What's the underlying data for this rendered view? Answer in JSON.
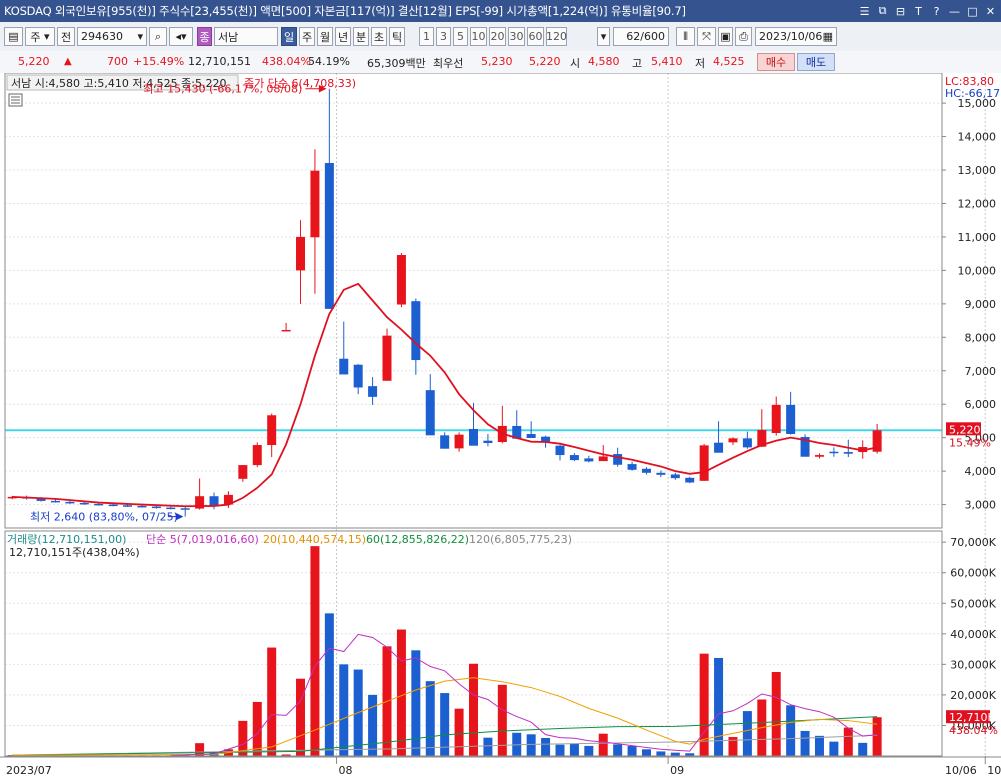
{
  "title_info": "KOSDAQ 외국인보유[955(천)] 주식수[23,455(천)] 액면[500] 자본금[117(억)] 결산[12월] EPS[-99] 시가총액[1,224(억)] 유통비율[90.7]",
  "window_icons": [
    "☰",
    "⧉",
    "⊟",
    "T",
    "?",
    "—",
    "□",
    "✕"
  ],
  "toolbar": {
    "type_label": "주",
    "prev_label": "전",
    "code": "294630",
    "stock_tag": "종",
    "stock_name": "서남",
    "periods": [
      "일",
      "주",
      "월",
      "년",
      "분",
      "초",
      "틱"
    ],
    "active_period": "일",
    "intervals": [
      "1",
      "3",
      "5",
      "10",
      "20",
      "30",
      "60",
      "120"
    ],
    "count": "62",
    "count_total": "/600",
    "date": "2023/10/06"
  },
  "quote": {
    "price": "5,220",
    "up_arrow": "▲",
    "change": "700",
    "change_pct": "+15.49%",
    "volume": "12,710,151",
    "vol_ratio": "438.04%",
    "turnover": "54.19%",
    "amount": "65,309백만",
    "best_label": "최우선",
    "best_ask": "5,230",
    "best_bid": "5,220",
    "open_label": "시",
    "open": "4,580",
    "high_label": "고",
    "high": "5,410",
    "low_label": "저",
    "low": "4,525",
    "buy_label": "매수",
    "sell_label": "매도"
  },
  "price_panel": {
    "ohlc_text": "서남 시:4,580 고:5,410 저:4,525 종:5,220",
    "ma_legend": "종가 단순 6(4,708,33)",
    "high_annot": "최고 15,430 (-66,17%, 08/08)",
    "low_annot": "최저 2,640 (83,80%, 07/25)",
    "lc_label": "LC:83,80",
    "hc_label": "HC:-66,17",
    "y_ticks": [
      "3,000",
      "4,000",
      "5,000",
      "6,000",
      "7,000",
      "8,000",
      "9,000",
      "10,000",
      "11,000",
      "12,000",
      "13,000",
      "14,000",
      "15,000"
    ],
    "price_tag": "5,220",
    "pct_tag": "15.49%"
  },
  "volume_panel": {
    "legend": [
      "거래량(12,710,151,00)",
      "단순 5(7,019,016,60)",
      "20(10,440,574,15)",
      "60(12,855,826,22)",
      "120(6,805,775,23)"
    ],
    "sub": "12,710,151주(438,04%)",
    "y_ticks": [
      "10,000K",
      "20,000K",
      "30,000K",
      "40,000K",
      "50,000K",
      "60,000K",
      "70,000K"
    ],
    "vol_tag": "12,710K",
    "pct_tag": "438.04%"
  },
  "x_labels": [
    {
      "text": "2023/07",
      "bar": -6
    },
    {
      "text": "08",
      "bar": 17
    },
    {
      "text": "09",
      "bar": 40
    },
    {
      "text": "10",
      "bar": 62
    }
  ],
  "x_label_right": "10/06",
  "colors": {
    "up": "#e8141c",
    "down": "#1c5fd0",
    "ma": "#e01020",
    "hline": "#43d8e8",
    "ma5": "#c030c0",
    "ma20": "#f0a000",
    "ma60": "#109040",
    "ma120": "#a0a0a0"
  },
  "chart_data": {
    "type": "candlestick",
    "n_bars": 65,
    "first_bar_index": -6,
    "candles": [
      [
        -6,
        3210,
        3260,
        3160,
        3230
      ],
      [
        -5,
        3230,
        3270,
        3150,
        3180
      ],
      [
        -4,
        3180,
        3220,
        3090,
        3110
      ],
      [
        -3,
        3110,
        3160,
        3060,
        3080
      ],
      [
        -2,
        3080,
        3130,
        3020,
        3050
      ],
      [
        -1,
        3050,
        3100,
        2990,
        3020
      ],
      [
        0,
        3020,
        3070,
        2970,
        3000
      ],
      [
        1,
        3000,
        3050,
        2950,
        2980
      ],
      [
        2,
        2980,
        3030,
        2930,
        2960
      ],
      [
        3,
        2960,
        3010,
        2910,
        2940
      ],
      [
        4,
        2940,
        2990,
        2880,
        2910
      ],
      [
        5,
        2910,
        2960,
        2860,
        2890
      ],
      [
        6,
        2890,
        2930,
        2640,
        2880
      ],
      [
        7,
        2880,
        3780,
        2850,
        3250
      ],
      [
        8,
        3250,
        3360,
        2860,
        2950
      ],
      [
        9,
        3000,
        3400,
        2900,
        3290
      ],
      [
        10,
        3770,
        4180,
        3680,
        4180
      ],
      [
        11,
        4180,
        4860,
        4120,
        4780
      ],
      [
        12,
        4780,
        5720,
        4420,
        5670
      ],
      [
        13,
        8220,
        8430,
        8220,
        8220
      ],
      [
        14,
        10000,
        11500,
        9000,
        11000
      ],
      [
        15,
        10990,
        13620,
        9300,
        12980
      ],
      [
        16,
        13210,
        15430,
        8850,
        8850
      ],
      [
        17,
        7360,
        8470,
        6900,
        6890
      ],
      [
        18,
        7180,
        7200,
        6300,
        6500
      ],
      [
        19,
        6540,
        6810,
        5980,
        6220
      ],
      [
        20,
        6700,
        8260,
        6700,
        8050
      ],
      [
        21,
        8980,
        10520,
        8900,
        10460
      ],
      [
        22,
        9080,
        9160,
        6880,
        7320
      ],
      [
        23,
        6420,
        6900,
        5100,
        5070
      ],
      [
        24,
        5070,
        5160,
        4720,
        4670
      ],
      [
        25,
        4680,
        5160,
        4580,
        5090
      ],
      [
        26,
        5260,
        6040,
        4830,
        4760
      ],
      [
        27,
        4910,
        5110,
        4740,
        4840
      ],
      [
        28,
        4870,
        5950,
        4830,
        5350
      ],
      [
        29,
        5350,
        5820,
        5000,
        4970
      ],
      [
        30,
        5110,
        5490,
        5000,
        4990
      ],
      [
        31,
        5030,
        5060,
        4700,
        4870
      ],
      [
        32,
        4760,
        4780,
        4320,
        4480
      ],
      [
        33,
        4480,
        4540,
        4300,
        4330
      ],
      [
        34,
        4380,
        4460,
        4260,
        4290
      ],
      [
        35,
        4300,
        4780,
        4300,
        4440
      ],
      [
        36,
        4510,
        4700,
        4130,
        4190
      ],
      [
        37,
        4210,
        4280,
        4010,
        4040
      ],
      [
        38,
        4070,
        4120,
        3900,
        3950
      ],
      [
        39,
        3950,
        4020,
        3820,
        3890
      ],
      [
        40,
        3900,
        3950,
        3740,
        3790
      ],
      [
        41,
        3800,
        3830,
        3640,
        3660
      ],
      [
        42,
        3710,
        4810,
        3710,
        4770
      ],
      [
        43,
        4850,
        5490,
        4720,
        4550
      ],
      [
        44,
        4860,
        5010,
        4780,
        4980
      ],
      [
        45,
        4980,
        5180,
        4670,
        4710
      ],
      [
        46,
        4730,
        5850,
        4720,
        5230
      ],
      [
        47,
        5140,
        6230,
        5060,
        5980
      ],
      [
        48,
        5980,
        6370,
        5090,
        5110
      ],
      [
        49,
        5020,
        5100,
        4450,
        4430
      ],
      [
        50,
        4430,
        4530,
        4380,
        4480
      ],
      [
        51,
        4580,
        4710,
        4430,
        4570
      ],
      [
        52,
        4570,
        4940,
        4420,
        4520
      ],
      [
        53,
        4570,
        4920,
        4370,
        4720
      ],
      [
        54,
        4580,
        5410,
        4525,
        5220
      ]
    ],
    "ma6": [
      [
        -6,
        3230
      ],
      [
        -3,
        3170
      ],
      [
        0,
        3060
      ],
      [
        3,
        3000
      ],
      [
        6,
        2950
      ],
      [
        8,
        2960
      ],
      [
        9,
        3000
      ],
      [
        10,
        3200
      ],
      [
        11,
        3500
      ],
      [
        12,
        3900
      ],
      [
        13,
        4800
      ],
      [
        14,
        6000
      ],
      [
        15,
        7450
      ],
      [
        16,
        8700
      ],
      [
        17,
        9420
      ],
      [
        18,
        9600
      ],
      [
        19,
        9100
      ],
      [
        20,
        8600
      ],
      [
        21,
        8230
      ],
      [
        22,
        7820
      ],
      [
        23,
        7450
      ],
      [
        24,
        6950
      ],
      [
        25,
        6300
      ],
      [
        26,
        5820
      ],
      [
        27,
        5400
      ],
      [
        28,
        5120
      ],
      [
        29,
        4990
      ],
      [
        30,
        4880
      ],
      [
        31,
        4870
      ],
      [
        32,
        4820
      ],
      [
        33,
        4720
      ],
      [
        34,
        4610
      ],
      [
        35,
        4500
      ],
      [
        36,
        4420
      ],
      [
        37,
        4340
      ],
      [
        38,
        4240
      ],
      [
        39,
        4140
      ],
      [
        40,
        4000
      ],
      [
        41,
        3920
      ],
      [
        42,
        3970
      ],
      [
        43,
        4190
      ],
      [
        44,
        4400
      ],
      [
        45,
        4600
      ],
      [
        46,
        4780
      ],
      [
        47,
        4910
      ],
      [
        48,
        5000
      ],
      [
        49,
        4930
      ],
      [
        50,
        4840
      ],
      [
        51,
        4780
      ],
      [
        52,
        4700
      ],
      [
        53,
        4620
      ],
      [
        54,
        4708
      ]
    ],
    "volume": [
      [
        -6,
        0.3,
        "u"
      ],
      [
        -5,
        0.3,
        "d"
      ],
      [
        -4,
        0.2,
        "d"
      ],
      [
        -3,
        0.2,
        "d"
      ],
      [
        -2,
        0.2,
        "d"
      ],
      [
        -1,
        0.2,
        "d"
      ],
      [
        0,
        0.2,
        "d"
      ],
      [
        1,
        0.2,
        "d"
      ],
      [
        2,
        0.2,
        "d"
      ],
      [
        3,
        0.2,
        "d"
      ],
      [
        4,
        0.2,
        "d"
      ],
      [
        5,
        0.2,
        "d"
      ],
      [
        6,
        0.3,
        "d"
      ],
      [
        7,
        4.2,
        "u"
      ],
      [
        8,
        1.3,
        "d"
      ],
      [
        9,
        2.2,
        "u"
      ],
      [
        10,
        11.5,
        "u"
      ],
      [
        11,
        17.7,
        "u"
      ],
      [
        12,
        35.5,
        "u"
      ],
      [
        13,
        0.5,
        "u"
      ],
      [
        14,
        25.3,
        "u"
      ],
      [
        15,
        68.7,
        "u"
      ],
      [
        16,
        46.7,
        "d"
      ],
      [
        17,
        30.0,
        "d"
      ],
      [
        18,
        28.3,
        "d"
      ],
      [
        19,
        20.0,
        "d"
      ],
      [
        20,
        35.9,
        "u"
      ],
      [
        21,
        41.4,
        "u"
      ],
      [
        22,
        34.6,
        "d"
      ],
      [
        23,
        24.5,
        "d"
      ],
      [
        24,
        20.6,
        "d"
      ],
      [
        25,
        15.5,
        "u"
      ],
      [
        26,
        30.2,
        "u"
      ],
      [
        27,
        6.0,
        "d"
      ],
      [
        28,
        23.3,
        "u"
      ],
      [
        29,
        7.6,
        "d"
      ],
      [
        30,
        7.1,
        "d"
      ],
      [
        31,
        5.9,
        "d"
      ],
      [
        32,
        3.7,
        "d"
      ],
      [
        33,
        4.1,
        "d"
      ],
      [
        34,
        3.3,
        "d"
      ],
      [
        35,
        7.3,
        "u"
      ],
      [
        36,
        3.8,
        "d"
      ],
      [
        37,
        3.3,
        "d"
      ],
      [
        38,
        2.2,
        "d"
      ],
      [
        39,
        1.5,
        "d"
      ],
      [
        40,
        1.1,
        "d"
      ],
      [
        41,
        0.9,
        "d"
      ],
      [
        42,
        33.5,
        "u"
      ],
      [
        43,
        32.1,
        "d"
      ],
      [
        44,
        6.2,
        "u"
      ],
      [
        45,
        14.7,
        "d"
      ],
      [
        46,
        18.5,
        "u"
      ],
      [
        47,
        27.5,
        "u"
      ],
      [
        48,
        16.6,
        "d"
      ],
      [
        49,
        8.2,
        "d"
      ],
      [
        50,
        6.6,
        "d"
      ],
      [
        51,
        4.7,
        "d"
      ],
      [
        52,
        9.3,
        "u"
      ],
      [
        53,
        4.3,
        "d"
      ],
      [
        54,
        12.7,
        "u"
      ]
    ],
    "vol_ma5": [
      [
        5,
        0.2
      ],
      [
        8,
        0.7
      ],
      [
        10,
        3.8
      ],
      [
        11,
        7.3
      ],
      [
        12,
        13.6
      ],
      [
        13,
        13.3
      ],
      [
        14,
        18.0
      ],
      [
        15,
        29.5
      ],
      [
        16,
        35.3
      ],
      [
        17,
        34.2
      ],
      [
        18,
        39.8
      ],
      [
        19,
        38.8
      ],
      [
        20,
        35.6
      ],
      [
        21,
        31.1
      ],
      [
        22,
        32.1
      ],
      [
        23,
        29.3
      ],
      [
        24,
        27.9
      ],
      [
        25,
        23.6
      ],
      [
        26,
        20.0
      ],
      [
        27,
        18.5
      ],
      [
        28,
        15.1
      ],
      [
        29,
        12.9
      ],
      [
        30,
        11.1
      ],
      [
        31,
        7.0
      ],
      [
        32,
        6.0
      ],
      [
        33,
        5.8
      ],
      [
        34,
        5.0
      ],
      [
        35,
        4.6
      ],
      [
        36,
        4.0
      ],
      [
        37,
        3.4
      ],
      [
        38,
        2.8
      ],
      [
        39,
        2.2
      ],
      [
        40,
        1.9
      ],
      [
        41,
        1.6
      ],
      [
        42,
        7.8
      ],
      [
        43,
        13.8
      ],
      [
        44,
        14.8
      ],
      [
        45,
        17.2
      ],
      [
        46,
        20.3
      ],
      [
        47,
        19.2
      ],
      [
        48,
        16.8
      ],
      [
        49,
        15.5
      ],
      [
        50,
        14.5
      ],
      [
        51,
        12.7
      ],
      [
        52,
        9.1
      ],
      [
        53,
        6.5
      ],
      [
        54,
        7.0
      ]
    ],
    "vol_ma20": [
      [
        -6,
        0.3
      ],
      [
        8,
        0.5
      ],
      [
        12,
        3.0
      ],
      [
        15,
        8.5
      ],
      [
        18,
        14.2
      ],
      [
        20,
        17.9
      ],
      [
        22,
        21.6
      ],
      [
        24,
        24.5
      ],
      [
        26,
        25.6
      ],
      [
        28,
        24.3
      ],
      [
        30,
        22.4
      ],
      [
        32,
        19.5
      ],
      [
        34,
        15.6
      ],
      [
        36,
        12.4
      ],
      [
        38,
        8.5
      ],
      [
        40,
        4.8
      ],
      [
        41,
        3.9
      ],
      [
        42,
        5.5
      ],
      [
        44,
        7.4
      ],
      [
        46,
        9.3
      ],
      [
        48,
        11.0
      ],
      [
        50,
        12.0
      ],
      [
        52,
        11.6
      ],
      [
        54,
        10.4
      ]
    ],
    "vol_ma60": [
      [
        -6,
        0.3
      ],
      [
        14,
        1.5
      ],
      [
        20,
        4.5
      ],
      [
        24,
        6.9
      ],
      [
        28,
        8.2
      ],
      [
        32,
        9.0
      ],
      [
        36,
        9.6
      ],
      [
        40,
        9.7
      ],
      [
        44,
        10.5
      ],
      [
        48,
        11.4
      ],
      [
        52,
        12.4
      ],
      [
        54,
        12.9
      ]
    ],
    "vol_ma120": [
      [
        -6,
        0.3
      ],
      [
        20,
        2.3
      ],
      [
        30,
        3.8
      ],
      [
        40,
        4.6
      ],
      [
        48,
        5.7
      ],
      [
        54,
        6.8
      ]
    ],
    "price_range": [
      2300,
      15900
    ],
    "volume_range": [
      0,
      73
    ]
  }
}
